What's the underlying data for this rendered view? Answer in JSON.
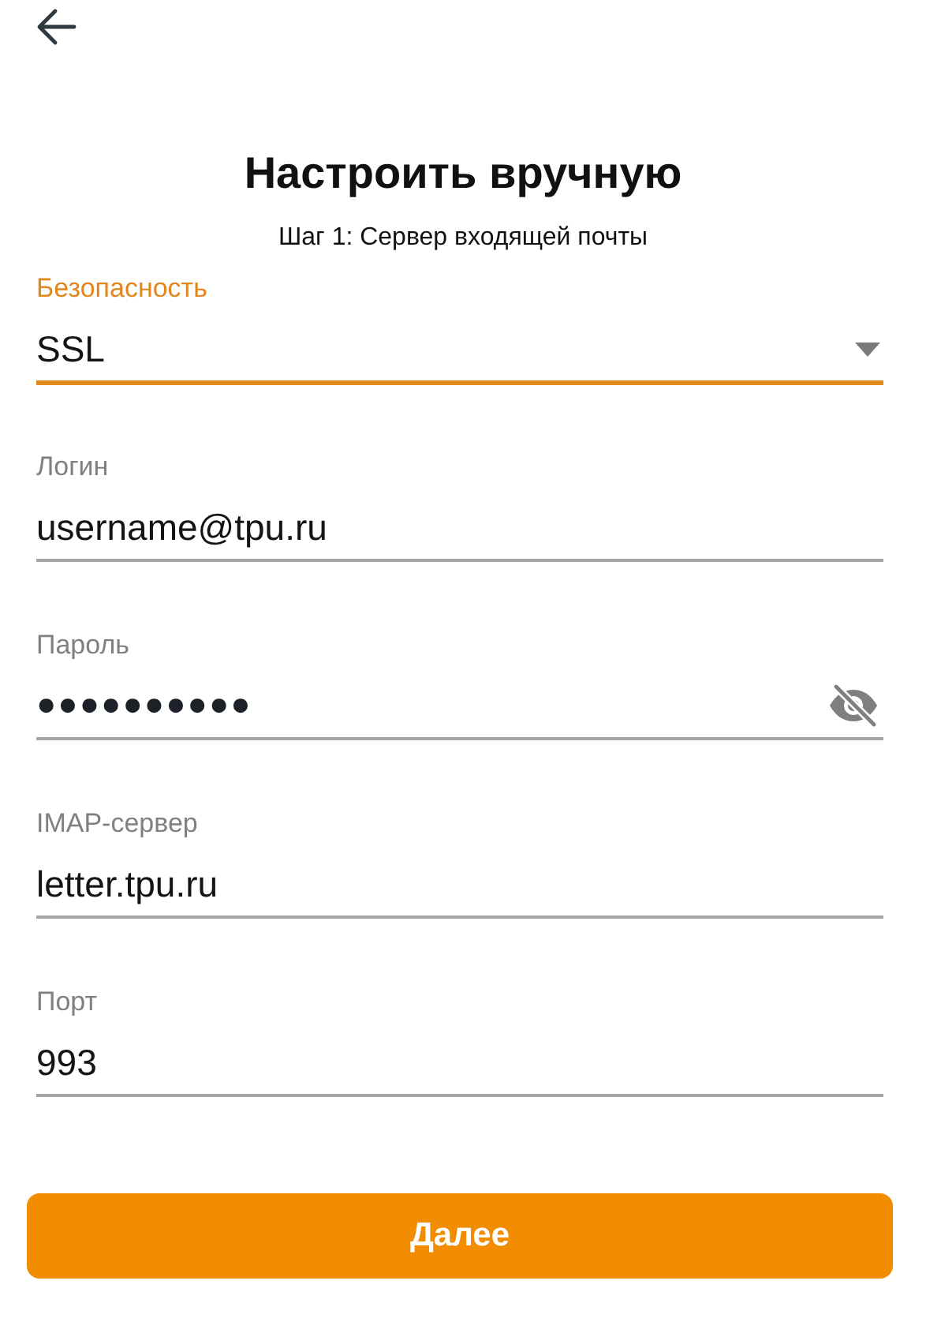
{
  "title": "Настроить вручную",
  "subtitle": "Шаг 1: Сервер входящей почты",
  "fields": [
    {
      "kind": "select",
      "label": "Безопасность",
      "value": "SSL",
      "focused": true
    },
    {
      "kind": "text",
      "label": "Логин",
      "value": "username@tpu.ru",
      "focused": false
    },
    {
      "kind": "password",
      "label": "Пароль",
      "value": "●●●●●●●●●●",
      "focused": false
    },
    {
      "kind": "text",
      "label": "IMAP-сервер",
      "value": "letter.tpu.ru",
      "focused": false
    },
    {
      "kind": "text",
      "label": "Порт",
      "value": "993",
      "focused": false
    }
  ],
  "button": "Далее"
}
